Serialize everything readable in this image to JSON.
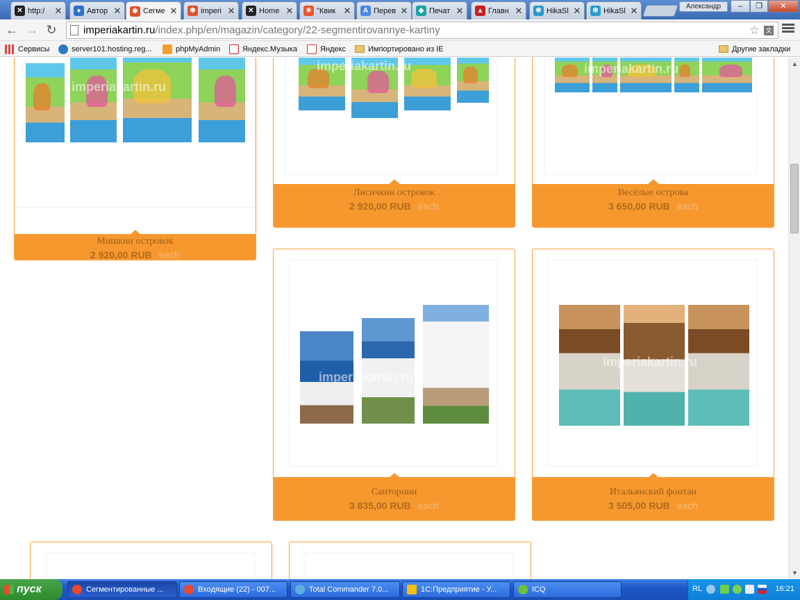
{
  "tabs": [
    {
      "title": "http:/",
      "color": "#222",
      "glyph": "✕"
    },
    {
      "title": "Автор",
      "color": "#2d72c8",
      "glyph": "●"
    },
    {
      "title": "Сегме",
      "color": "#e0502a",
      "glyph": "✱"
    },
    {
      "title": "imperi",
      "color": "#e0502a",
      "glyph": "✱"
    },
    {
      "title": "Home",
      "color": "#222",
      "glyph": "✕"
    },
    {
      "title": "\"Квик",
      "color": "#e8572f",
      "glyph": "✳"
    },
    {
      "title": "Перев",
      "color": "#4a86e8",
      "glyph": "A"
    },
    {
      "title": "Печат",
      "color": "#1aa3a3",
      "glyph": "◆"
    },
    {
      "title": "Главн",
      "color": "#c71f1f",
      "glyph": "▲"
    },
    {
      "title": "HikaSl",
      "color": "#2a9bd0",
      "glyph": "✻"
    },
    {
      "title": "HikaSl",
      "color": "#2a9bd0",
      "glyph": "✻"
    }
  ],
  "window": {
    "user": "Александр"
  },
  "address": {
    "host": "imperiakartin.ru",
    "path": "/index.php/en/magazin/category/22-segmentirovannye-kartiny"
  },
  "bookmarks": [
    {
      "label": "Сервисы",
      "color": "#d44"
    },
    {
      "label": "server101.hosting.reg...",
      "color": "#2f78c4"
    },
    {
      "label": "phpMyAdmin",
      "color": "#f0a030"
    },
    {
      "label": "Яндекс.Музыка",
      "color": "#cc2222"
    },
    {
      "label": "Яндекс",
      "color": "#e03030"
    },
    {
      "label": "Импортировано из IE",
      "color": "#e8c46a"
    }
  ],
  "other_bookmarks": "Другие закладки",
  "watermark": "imperiakartin.ru",
  "products": [
    {
      "name": "Мишкин островок",
      "price": "2 920,00 RUB",
      "each": "each"
    },
    {
      "name": "Лисичкин островок",
      "price": "2 920,00 RUB",
      "each": "each"
    },
    {
      "name": "Весёлые острова",
      "price": "3 650,00 RUB",
      "each": "each"
    },
    {
      "name": "Санторини",
      "price": "3 835,00 RUB",
      "each": "each"
    },
    {
      "name": "Итальянский фонтан",
      "price": "3 505,00 RUB",
      "each": "each"
    }
  ],
  "taskbar": {
    "start": "пуск",
    "tasks": [
      {
        "label": "Сегментированные ...",
        "color": "#e6492e"
      },
      {
        "label": "Входящие (22) - 007...",
        "color": "#e6492e"
      },
      {
        "label": "Total Commander 7.0...",
        "color": "#5fb0e0"
      },
      {
        "label": "1С:Предприятие - У...",
        "color": "#f4c000"
      },
      {
        "label": "ICQ",
        "color": "#6fc03c"
      }
    ],
    "lang": "RL",
    "clock": "16:21"
  }
}
